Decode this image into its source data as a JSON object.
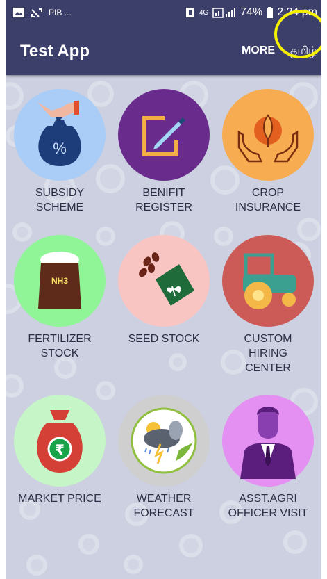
{
  "status_bar": {
    "left_icons": [
      "image-icon",
      "cast-icon"
    ],
    "left_text": "PIB ...",
    "network": "4G",
    "battery": "74%",
    "time": "2:24 pm"
  },
  "app_bar": {
    "title": "Test App",
    "more": "MORE",
    "language": "தமிழ்"
  },
  "tiles": [
    {
      "label": "SUBSIDY\nSCHEME",
      "bg": "#a9cdf6",
      "icon": "money-bag-icon"
    },
    {
      "label": "BENIFIT\nREGISTER",
      "bg": "#6a2c8c",
      "icon": "document-pen-icon"
    },
    {
      "label": "CROP\nINSURANCE",
      "bg": "#f7ac52",
      "icon": "hands-plant-icon"
    },
    {
      "label": "FERTILIZER\nSTOCK",
      "bg": "#8ff597",
      "icon": "fertilizer-sack-icon"
    },
    {
      "label": "SEED STOCK",
      "bg": "#f8c5c2",
      "icon": "seed-packet-icon"
    },
    {
      "label": "CUSTOM\nHIRING\nCENTER",
      "bg": "#cc5a57",
      "icon": "tractor-icon"
    },
    {
      "label": "MARKET PRICE",
      "bg": "#c6f5c7",
      "icon": "rupee-bag-icon"
    },
    {
      "label": "WEATHER\nFORECAST",
      "bg": "#cfcfcf",
      "icon": "weather-storm-icon"
    },
    {
      "label": "ASST.AGRI\nOFFICER VISIT",
      "bg": "#e48ff2",
      "icon": "officer-icon"
    }
  ]
}
